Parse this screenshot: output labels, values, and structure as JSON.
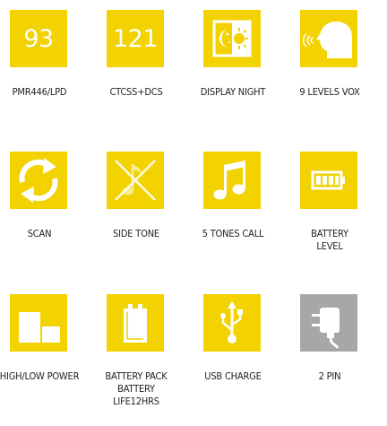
{
  "colors": {
    "tile_yellow": "#f2d200",
    "tile_grey": "#a7a7a7",
    "icon_white": "#ffffff",
    "caption_text": "#222222"
  },
  "features": [
    {
      "icon": "number-93",
      "value": "93",
      "label": "PMR446/LPD"
    },
    {
      "icon": "number-121",
      "value": "121",
      "label": "CTCSS+DCS"
    },
    {
      "icon": "moon-sun-icon",
      "label": "DISPLAY NIGHT"
    },
    {
      "icon": "head-voice-icon",
      "label": "9 LEVELS VOX"
    },
    {
      "icon": "scan-arrows-icon",
      "label": "SCAN"
    },
    {
      "icon": "muted-note-icon",
      "label": "SIDE TONE"
    },
    {
      "icon": "music-note-icon",
      "label": "5 TONES CALL"
    },
    {
      "icon": "battery-icon",
      "label_lines": [
        "BATTERY",
        "LEVEL"
      ]
    },
    {
      "icon": "power-blocks-icon",
      "label": "HIGH/LOW POWER"
    },
    {
      "icon": "battery-pack-icon",
      "label_lines": [
        "BATTERY PACK",
        "BATTERY",
        "LIFE12HRS"
      ]
    },
    {
      "icon": "usb-icon",
      "label": "USB CHARGE"
    },
    {
      "icon": "plug-icon",
      "label": "2 PIN"
    }
  ]
}
